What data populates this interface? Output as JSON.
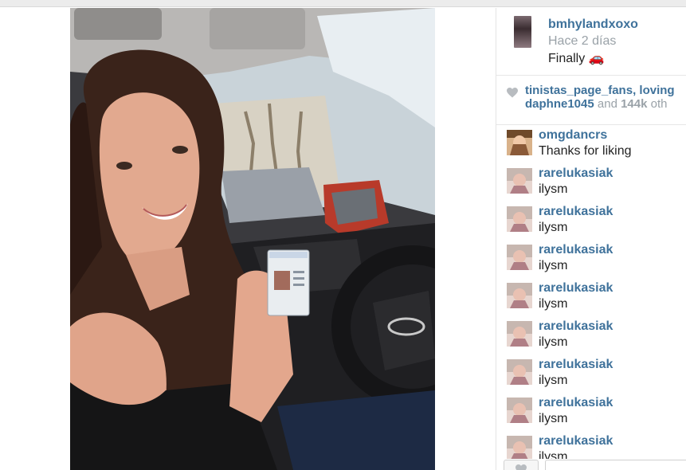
{
  "post": {
    "username": "bmhylandxoxo",
    "time_ago": "Hace 2 días",
    "caption": "Finally 🚗"
  },
  "likes": {
    "user1": "tinistas_page_fans",
    "user1_suffix": ",",
    "user2": "loving",
    "user3": "daphne1045",
    "and_text": "and",
    "count": "144k",
    "others": "oth"
  },
  "comments": [
    {
      "user": "omgdancrs",
      "text": "Thanks for liking"
    },
    {
      "user": "rarelukasiak",
      "text": "ilysm"
    },
    {
      "user": "rarelukasiak",
      "text": "ilysm"
    },
    {
      "user": "rarelukasiak",
      "text": "ilysm"
    },
    {
      "user": "rarelukasiak",
      "text": "ilysm"
    },
    {
      "user": "rarelukasiak",
      "text": "ilysm"
    },
    {
      "user": "rarelukasiak",
      "text": "ilysm"
    },
    {
      "user": "rarelukasiak",
      "text": "ilysm"
    },
    {
      "user": "rarelukasiak",
      "text": "ilysm"
    }
  ],
  "colors": {
    "link": "#3f729b",
    "muted": "#9aa2a8",
    "text": "#222222"
  }
}
